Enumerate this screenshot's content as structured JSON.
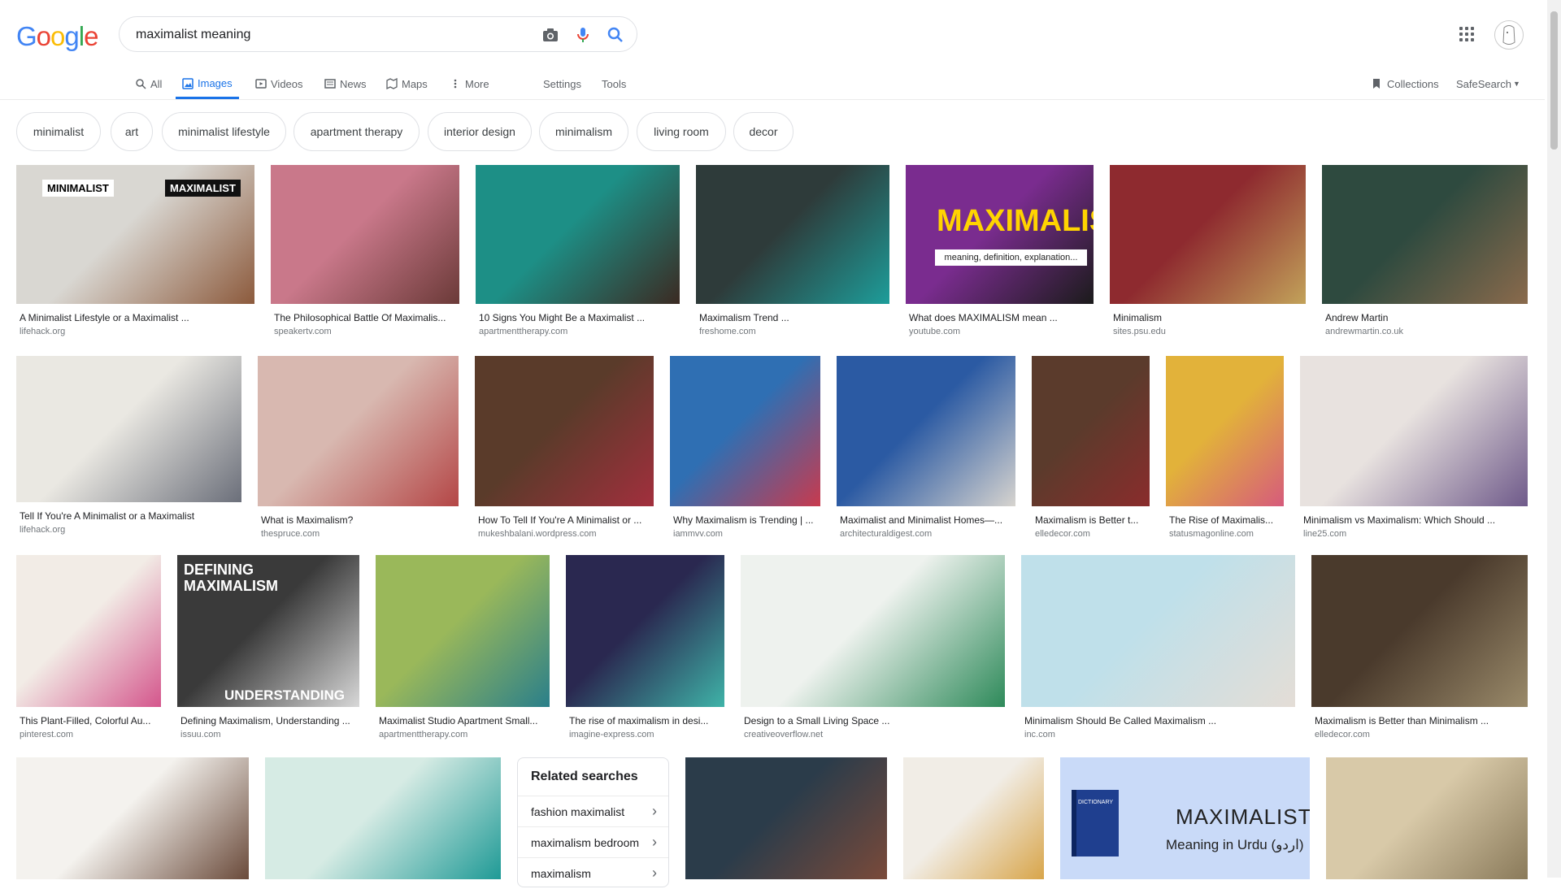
{
  "logo": {
    "letters": [
      "G",
      "o",
      "o",
      "g",
      "l",
      "e"
    ],
    "colors": [
      "#4285f4",
      "#ea4335",
      "#fbbc05",
      "#4285f4",
      "#34a853",
      "#ea4335"
    ]
  },
  "search": {
    "query": "maximalist meaning"
  },
  "tabs": [
    {
      "label": "All",
      "icon": "search-icon"
    },
    {
      "label": "Images",
      "icon": "image-icon"
    },
    {
      "label": "Videos",
      "icon": "video-icon"
    },
    {
      "label": "News",
      "icon": "news-icon"
    },
    {
      "label": "Maps",
      "icon": "map-icon"
    },
    {
      "label": "More",
      "icon": "more-dots-icon"
    },
    {
      "label": "Settings"
    },
    {
      "label": "Tools"
    }
  ],
  "right_tabs": {
    "collections": "Collections",
    "safesearch": "SafeSearch"
  },
  "chips": [
    "minimalist",
    "art",
    "minimalist lifestyle",
    "apartment therapy",
    "interior design",
    "minimalism",
    "living room",
    "decor"
  ],
  "results": [
    {
      "caption": "A Minimalist Lifestyle or a Maximalist ...",
      "source": "lifehack.org",
      "overlay_left": "MINIMALIST",
      "overlay_right": "MAXIMALIST",
      "colors": [
        "#d9d7d2",
        "#8c5a3c"
      ]
    },
    {
      "caption": "The Philosophical Battle Of Maximalis...",
      "source": "speakertv.com",
      "colors": [
        "#c9788a",
        "#6b3a38"
      ]
    },
    {
      "caption": "10 Signs You Might Be a Maximalist ...",
      "source": "apartmenttherapy.com",
      "colors": [
        "#1d8f86",
        "#3b2a22"
      ]
    },
    {
      "caption": "Maximalism Trend ...",
      "source": "freshome.com",
      "colors": [
        "#2e3b3a",
        "#1d9d9a"
      ]
    },
    {
      "caption": "What does MAXIMALISM mean ...",
      "source": "youtube.com",
      "overlay_title": "MAXIMALISM",
      "overlay_sub": "meaning, definition, explanation...",
      "colors": [
        "#7a2c8f",
        "#1b1b1b"
      ]
    },
    {
      "caption": "Minimalism",
      "source": "sites.psu.edu",
      "colors": [
        "#8e2a2f",
        "#c2a25a"
      ]
    },
    {
      "caption": "Andrew Martin",
      "source": "andrewmartin.co.uk",
      "colors": [
        "#2e4a3f",
        "#8a6a4c"
      ]
    },
    {
      "caption": "Tell If You're A Minimalist or a Maximalist",
      "source": "lifehack.org",
      "colors": [
        "#eae8e2",
        "#6b6f7a"
      ]
    },
    {
      "caption": "What is Maximalism?",
      "source": "thespruce.com",
      "colors": [
        "#d8b8b0",
        "#b44646"
      ]
    },
    {
      "caption": "How To Tell If You're A Minimalist or ...",
      "source": "mukeshbalani.wordpress.com",
      "colors": [
        "#5a3b2a",
        "#a22f3d"
      ]
    },
    {
      "caption": "Why Maximalism is Trending | ...",
      "source": "iammvv.com",
      "colors": [
        "#2f6fb3",
        "#c83a4e"
      ]
    },
    {
      "caption": "Maximalist and Minimalist Homes—...",
      "source": "architecturaldigest.com",
      "colors": [
        "#2b5aa3",
        "#d7d4cf"
      ]
    },
    {
      "caption": "Maximalism is Better t...",
      "source": "elledecor.com",
      "colors": [
        "#5b3b2c",
        "#8a2c2c"
      ]
    },
    {
      "caption": "The Rise of Maximalis...",
      "source": "statusmagonline.com",
      "colors": [
        "#e2b23a",
        "#d65b7c"
      ]
    },
    {
      "caption": "Minimalism vs Maximalism: Which Should ...",
      "source": "line25.com",
      "colors": [
        "#e8e2df",
        "#6f5a8a"
      ]
    },
    {
      "caption": "This Plant-Filled, Colorful Au...",
      "source": "pinterest.com",
      "colors": [
        "#f2ece6",
        "#d4568c"
      ]
    },
    {
      "caption": "Defining Maximalism, Understanding ...",
      "source": "issuu.com",
      "overlay_title": "DEFINING MAXIMALISM",
      "overlay_sub": "UNDERSTANDING",
      "colors": [
        "#3a3a3a",
        "#d8d8d8"
      ]
    },
    {
      "caption": "Maximalist Studio Apartment Small...",
      "source": "apartmenttherapy.com",
      "colors": [
        "#9ab85a",
        "#2a7f8a"
      ]
    },
    {
      "caption": "The rise of maximalism in desi...",
      "source": "imagine-express.com",
      "colors": [
        "#2a2850",
        "#3fb3a8"
      ]
    },
    {
      "caption": "Design to a Small Living Space ...",
      "source": "creativeoverflow.net",
      "colors": [
        "#eef2ee",
        "#2e8a5a"
      ]
    },
    {
      "caption": "Minimalism Should Be Called Maximalism ...",
      "source": "inc.com",
      "colors": [
        "#bfe0ea",
        "#e4ddd6"
      ]
    },
    {
      "caption": "Maximalism is Better than Minimalism ...",
      "source": "elledecor.com",
      "colors": [
        "#4a3a2c",
        "#9a8a6a"
      ]
    }
  ],
  "bottom_row": [
    {
      "colors": [
        "#f4f2ee",
        "#6a4a3a"
      ]
    },
    {
      "colors": [
        "#d6ebe4",
        "#1f9a96"
      ]
    },
    {
      "colors": [
        "#2b3c4a",
        "#7a4a3a"
      ]
    },
    {
      "colors": [
        "#f1ede6",
        "#d8a54a"
      ]
    },
    {
      "overlay_title": "MAXIMALIST",
      "overlay_sub": "Meaning in Urdu (اردو)",
      "book_label": "DICTIONARY",
      "colors": [
        "#c9daf8",
        "#1f3f8f"
      ]
    },
    {
      "colors": [
        "#d8c9a8",
        "#8a7a5a"
      ]
    }
  ],
  "related": {
    "title": "Related searches",
    "items": [
      "fashion maximalist",
      "maximalism bedroom",
      "maximalism"
    ]
  }
}
